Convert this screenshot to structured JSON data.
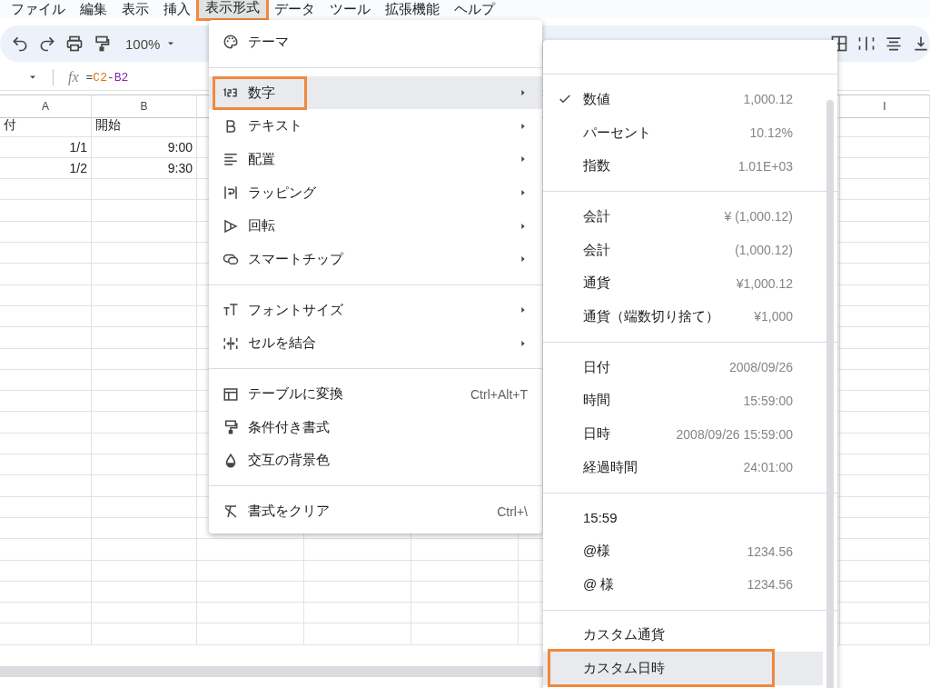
{
  "menubar": [
    {
      "label": "ファイル",
      "selected": false,
      "annotated": false
    },
    {
      "label": "編集",
      "selected": false,
      "annotated": false
    },
    {
      "label": "表示",
      "selected": false,
      "annotated": false
    },
    {
      "label": "挿入",
      "selected": false,
      "annotated": false
    },
    {
      "label": "表示形式",
      "selected": true,
      "annotated": true
    },
    {
      "label": "データ",
      "selected": false,
      "annotated": false
    },
    {
      "label": "ツール",
      "selected": false,
      "annotated": false
    },
    {
      "label": "拡張機能",
      "selected": false,
      "annotated": false
    },
    {
      "label": "ヘルプ",
      "selected": false,
      "annotated": false
    }
  ],
  "toolbar": {
    "zoom": "100%"
  },
  "formula_bar": {
    "function_label": "fx",
    "tokens": [
      {
        "text": "="
      },
      {
        "text": "C2",
        "color": "#e8710a"
      },
      {
        "text": "-"
      },
      {
        "text": "B2",
        "color": "#8e24aa"
      }
    ]
  },
  "grid": {
    "columns": [
      "A",
      "B",
      "I"
    ],
    "rows": [
      {
        "kind": "text",
        "cells": [
          "付",
          "開始"
        ]
      },
      {
        "kind": "number",
        "cells": [
          "1/1",
          "9:00"
        ]
      },
      {
        "kind": "number",
        "cells": [
          "1/2",
          "9:30"
        ]
      }
    ]
  },
  "format_menu": {
    "groups": [
      [
        {
          "kind": "palette",
          "label": "テーマ",
          "submenu": false,
          "selected": false,
          "annotated": false
        }
      ],
      [
        {
          "kind": "number",
          "label": "数字",
          "submenu": true,
          "selected": true,
          "annotated": true
        },
        {
          "kind": "bold",
          "label": "テキスト",
          "submenu": true,
          "selected": false,
          "annotated": false
        },
        {
          "kind": "align",
          "label": "配置",
          "submenu": true,
          "selected": false,
          "annotated": false
        },
        {
          "kind": "wrap",
          "label": "ラッピング",
          "submenu": true,
          "selected": false,
          "annotated": false
        },
        {
          "kind": "rotate",
          "label": "回転",
          "submenu": true,
          "selected": false,
          "annotated": false
        },
        {
          "kind": "chip",
          "label": "スマートチップ",
          "submenu": true,
          "selected": false,
          "annotated": false
        }
      ],
      [
        {
          "kind": "fontsize",
          "label": "フォントサイズ",
          "submenu": true,
          "selected": false,
          "annotated": false
        },
        {
          "kind": "merge",
          "label": "セルを結合",
          "submenu": true,
          "selected": false,
          "annotated": false
        }
      ],
      [
        {
          "kind": "table",
          "label": "テーブルに変換",
          "shortcut": "Ctrl+Alt+T",
          "submenu": false,
          "selected": false,
          "annotated": false
        },
        {
          "kind": "paint",
          "label": "条件付き書式",
          "submenu": false,
          "selected": false,
          "annotated": false
        },
        {
          "kind": "drop",
          "label": "交互の背景色",
          "submenu": false,
          "selected": false,
          "annotated": false
        }
      ],
      [
        {
          "kind": "clear",
          "label": "書式をクリア",
          "shortcut": "Ctrl+\\",
          "submenu": false,
          "selected": false,
          "annotated": false
        }
      ]
    ]
  },
  "number_submenu": {
    "groups": [
      [
        {
          "label": "数値",
          "example": "1,000.12",
          "checked": true,
          "selected": false,
          "annotated": false
        },
        {
          "label": "パーセント",
          "example": "10.12%",
          "checked": false,
          "selected": false,
          "annotated": false
        },
        {
          "label": "指数",
          "example": "1.01E+03",
          "checked": false,
          "selected": false,
          "annotated": false
        }
      ],
      [
        {
          "label": "会計",
          "example": "¥ (1,000.12)",
          "checked": false,
          "selected": false,
          "annotated": false
        },
        {
          "label": "会計",
          "example": "(1,000.12)",
          "checked": false,
          "selected": false,
          "annotated": false
        },
        {
          "label": "通貨",
          "example": "¥1,000.12",
          "checked": false,
          "selected": false,
          "annotated": false
        },
        {
          "label": "通貨（端数切り捨て）",
          "example": "¥1,000",
          "checked": false,
          "selected": false,
          "annotated": false
        }
      ],
      [
        {
          "label": "日付",
          "example": "2008/09/26",
          "checked": false,
          "selected": false,
          "annotated": false
        },
        {
          "label": "時間",
          "example": "15:59:00",
          "checked": false,
          "selected": false,
          "annotated": false
        },
        {
          "label": "日時",
          "example": "2008/09/26 15:59:00",
          "checked": false,
          "selected": false,
          "annotated": false
        },
        {
          "label": "経過時間",
          "example": "24:01:00",
          "checked": false,
          "selected": false,
          "annotated": false
        }
      ],
      [
        {
          "label": "15:59",
          "checked": false,
          "selected": false,
          "annotated": false
        },
        {
          "label": "@様",
          "example": "1234.56",
          "checked": false,
          "selected": false,
          "annotated": false
        },
        {
          "label": "@ 様",
          "example": "1234.56",
          "checked": false,
          "selected": false,
          "annotated": false
        }
      ],
      [
        {
          "label": "カスタム通貨",
          "checked": false,
          "selected": false,
          "annotated": false
        },
        {
          "label": "カスタム日時",
          "checked": false,
          "selected": true,
          "annotated": true
        }
      ]
    ]
  }
}
